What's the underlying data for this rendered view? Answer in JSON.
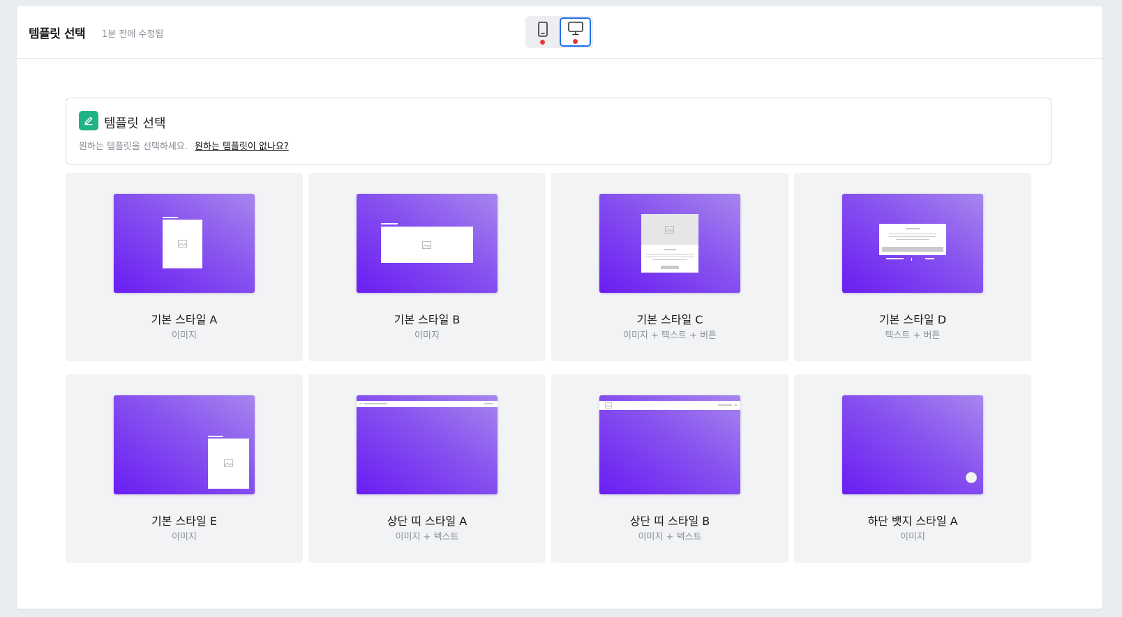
{
  "header": {
    "title": "템플릿 선택",
    "saved_status": "1분 전에 수정됨"
  },
  "device_toggle": {
    "options": [
      {
        "icon": "mobile-icon",
        "selected": false,
        "status_color": "#e53935"
      },
      {
        "icon": "desktop-icon",
        "selected": true,
        "status_color": "#e53935"
      }
    ]
  },
  "info": {
    "icon": "pencil-icon",
    "title": "템플릿 선택",
    "description": "원하는 템플릿을 선택하세요.",
    "link": "원하는 템플릿이 없나요?"
  },
  "templates": [
    {
      "title": "기본 스타일 A",
      "subtitle": "이미지"
    },
    {
      "title": "기본 스타일 B",
      "subtitle": "이미지"
    },
    {
      "title": "기본 스타일 C",
      "subtitle": "이미지 + 텍스트 + 버튼"
    },
    {
      "title": "기본 스타일 D",
      "subtitle": "텍스트 + 버튼"
    },
    {
      "title": "기본 스타일 E",
      "subtitle": "이미지"
    },
    {
      "title": "상단 띠 스타일 A",
      "subtitle": "이미지 + 텍스트"
    },
    {
      "title": "상단 띠 스타일 B",
      "subtitle": "이미지 + 텍스트"
    },
    {
      "title": "하단 뱃지 스타일 A",
      "subtitle": "이미지"
    }
  ],
  "colors": {
    "accent": "#1f6feb",
    "brand_green": "#1fb286",
    "thumb_gradient_start": "#a786ee",
    "thumb_gradient_end": "#6a1df2"
  }
}
